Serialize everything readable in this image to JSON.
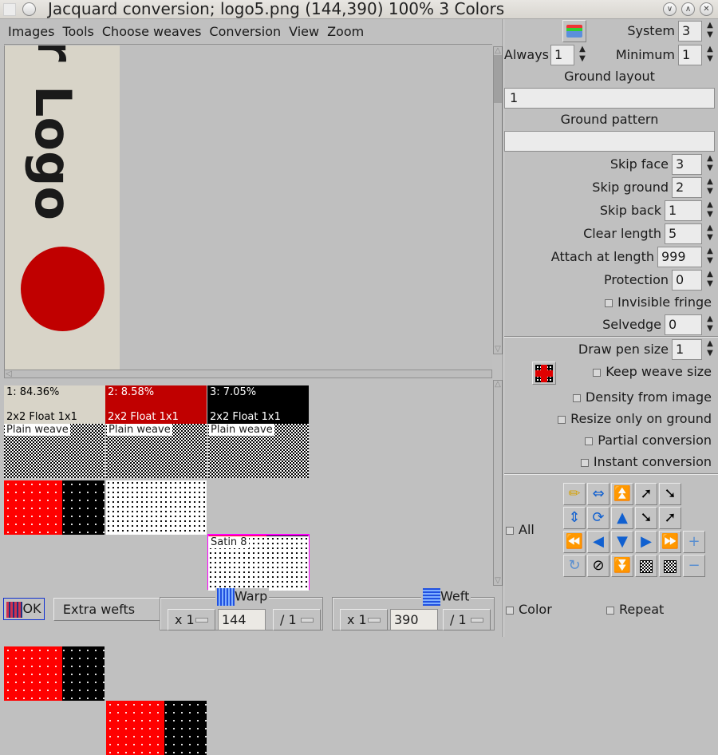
{
  "window": {
    "title": "Jacquard conversion; logo5.png (144,390) 100% 3 Colors",
    "controls": [
      "minimize",
      "maximize",
      "close"
    ]
  },
  "menu": [
    "Images",
    "Tools",
    "Choose weaves",
    "Conversion",
    "View",
    "Zoom"
  ],
  "image": {
    "text_rotated": "Logo",
    "text_partial": "r",
    "colors": {
      "background": "#d8d4c8",
      "text": "#000000",
      "circle": "#c00000"
    }
  },
  "colors": [
    {
      "label": "1: 84.36%",
      "weave": "2x2 Float 1x1",
      "bg": "#d8d4c8",
      "fg": "#000000"
    },
    {
      "label": "2: 8.58%",
      "weave": "2x2 Float 1x1",
      "bg": "#c00000",
      "fg": "#ffffff"
    },
    {
      "label": "3: 7.05%",
      "weave": "2x2 Float 1x1",
      "bg": "#000000",
      "fg": "#ffffff"
    }
  ],
  "weave_cells": {
    "row1": [
      "Plain weave",
      "Plain weave",
      "Plain weave"
    ],
    "row3_col3": "Satin 8"
  },
  "right_panel": {
    "system_label": "System",
    "system_value": "3",
    "always_label": "Always",
    "always_value": "1",
    "minimum_label": "Minimum",
    "minimum_value": "1",
    "ground_layout_label": "Ground layout",
    "ground_layout_value": "1",
    "ground_pattern_label": "Ground pattern",
    "ground_pattern_value": "",
    "fields": [
      {
        "label": "Skip face",
        "value": "3"
      },
      {
        "label": "Skip ground",
        "value": "2"
      },
      {
        "label": "Skip back",
        "value": "1"
      },
      {
        "label": "Clear length",
        "value": "5"
      },
      {
        "label": "Attach at length",
        "value": "999"
      },
      {
        "label": "Protection",
        "value": "0"
      }
    ],
    "invisible_fringe": "Invisible fringe",
    "selvedge_label": "Selvedge",
    "selvedge_value": "0",
    "draw_pen_label": "Draw pen size",
    "draw_pen_value": "1",
    "checkboxes": [
      {
        "label": "Keep weave size",
        "checked": false
      },
      {
        "label": "Density from image",
        "checked": false
      },
      {
        "label": "Resize only on ground",
        "checked": false
      },
      {
        "label": "Partial conversion",
        "checked": false
      },
      {
        "label": "Instant conversion",
        "checked": false
      }
    ],
    "all_label": "All",
    "tools": [
      [
        "broom-icon",
        "flip-horizontal-icon",
        "double-up-icon",
        "shift-right-diagonal-icon",
        "shift-left-diagonal-icon"
      ],
      [
        "flip-vertical-icon",
        "rotate-icon",
        "up-icon",
        "shift-down-diagonal-icon",
        "shift-up-diagonal-icon"
      ],
      [
        "first-icon",
        "left-icon",
        "down-icon",
        "right-icon",
        "last-icon",
        "plus-icon"
      ],
      [
        "refresh-icon",
        "invert-icon",
        "double-down-icon",
        "move-down-right-icon",
        "move-up-left-icon",
        "minus-icon"
      ]
    ]
  },
  "bottom": {
    "ok_label": "OK",
    "extra_wefts_label": "Extra wefts",
    "warp": {
      "title": "Warp",
      "multiplier": "x 1",
      "value": "144",
      "divisor": "/ 1"
    },
    "weft": {
      "title": "Weft",
      "multiplier": "x 1",
      "value": "390",
      "divisor": "/ 1"
    },
    "color_label": "Color",
    "repeat_label": "Repeat"
  }
}
